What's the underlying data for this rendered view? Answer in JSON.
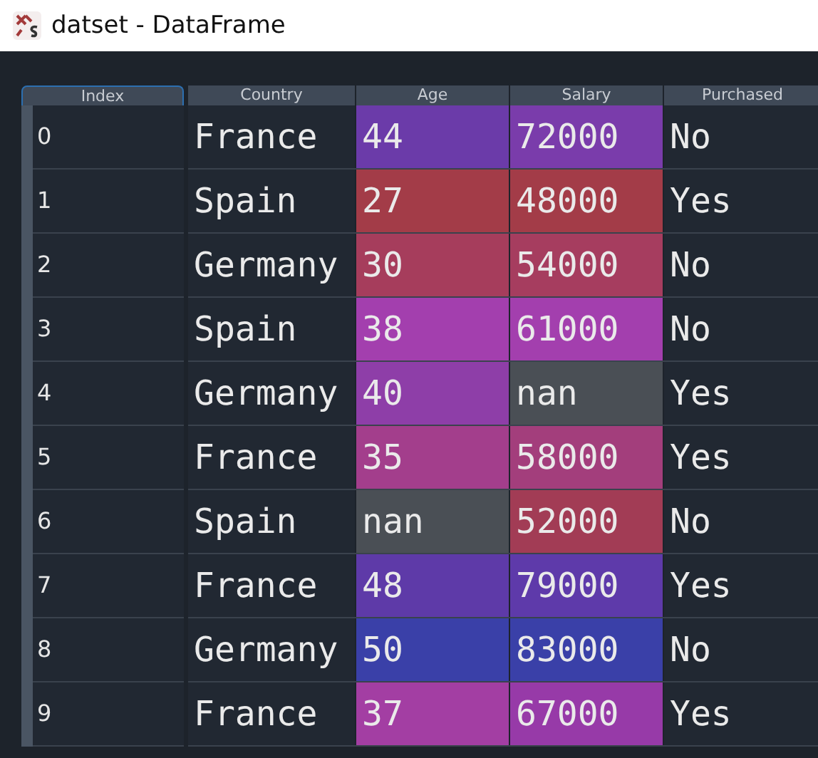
{
  "window": {
    "title": "datset - DataFrame"
  },
  "table": {
    "index_header": "Index",
    "columns": [
      "Country",
      "Age",
      "Salary",
      "Purchased"
    ],
    "rows": [
      {
        "index": "0",
        "country": "France",
        "age": {
          "text": "44",
          "color": "#6b3ba9"
        },
        "salary": {
          "text": "72000",
          "color": "#7a3cab"
        },
        "purchased": "No"
      },
      {
        "index": "1",
        "country": "Spain",
        "age": {
          "text": "27",
          "color": "#a33c48"
        },
        "salary": {
          "text": "48000",
          "color": "#a33c48"
        },
        "purchased": "Yes"
      },
      {
        "index": "2",
        "country": "Germany",
        "age": {
          "text": "30",
          "color": "#a63d5c"
        },
        "salary": {
          "text": "54000",
          "color": "#a63d5f"
        },
        "purchased": "No"
      },
      {
        "index": "3",
        "country": "Spain",
        "age": {
          "text": "38",
          "color": "#a33fae"
        },
        "salary": {
          "text": "61000",
          "color": "#a33fae"
        },
        "purchased": "No"
      },
      {
        "index": "4",
        "country": "Germany",
        "age": {
          "text": "40",
          "color": "#8e3ea8"
        },
        "salary": {
          "text": "nan",
          "color": "#4a4f55"
        },
        "purchased": "Yes"
      },
      {
        "index": "5",
        "country": "France",
        "age": {
          "text": "35",
          "color": "#a33e8c"
        },
        "salary": {
          "text": "58000",
          "color": "#a33e7c"
        },
        "purchased": "Yes"
      },
      {
        "index": "6",
        "country": "Spain",
        "age": {
          "text": "nan",
          "color": "#4a4f55"
        },
        "salary": {
          "text": "52000",
          "color": "#a23c55"
        },
        "purchased": "No"
      },
      {
        "index": "7",
        "country": "France",
        "age": {
          "text": "48",
          "color": "#5e3aa8"
        },
        "salary": {
          "text": "79000",
          "color": "#5e3aaa"
        },
        "purchased": "Yes"
      },
      {
        "index": "8",
        "country": "Germany",
        "age": {
          "text": "50",
          "color": "#3a40a8"
        },
        "salary": {
          "text": "83000",
          "color": "#3a40a8"
        },
        "purchased": "No"
      },
      {
        "index": "9",
        "country": "France",
        "age": {
          "text": "37",
          "color": "#a33ea3"
        },
        "salary": {
          "text": "67000",
          "color": "#973aa8"
        },
        "purchased": "Yes"
      }
    ]
  }
}
